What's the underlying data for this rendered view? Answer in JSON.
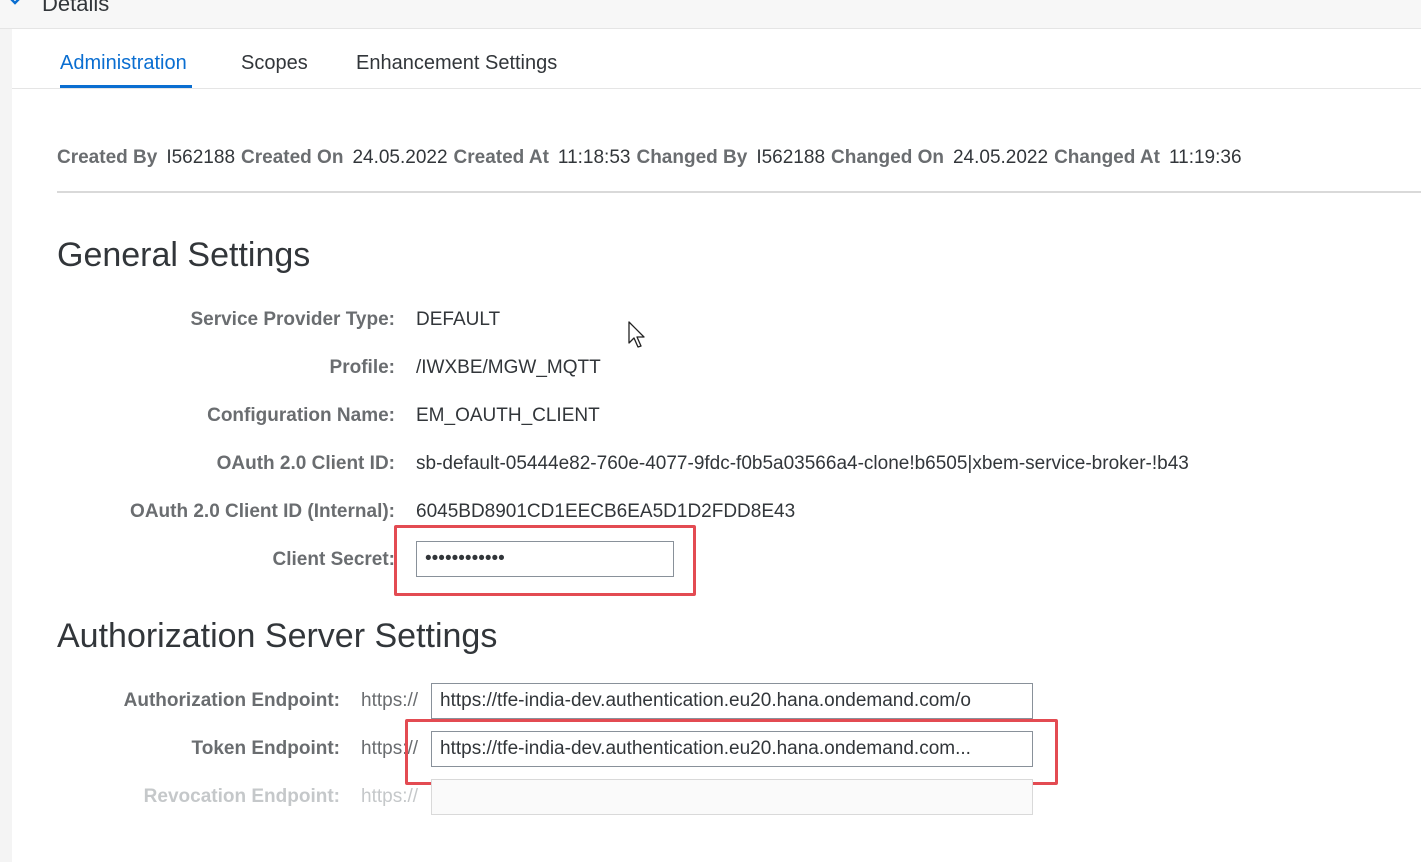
{
  "header": {
    "title": "Details"
  },
  "tabs": [
    {
      "label": "Administration",
      "active": true
    },
    {
      "label": "Scopes",
      "active": false
    },
    {
      "label": "Enhancement Settings",
      "active": false
    }
  ],
  "audit": {
    "created_by_label": "Created By",
    "created_by": "I562188",
    "created_on_label": "Created On",
    "created_on": "24.05.2022",
    "created_at_label": "Created At",
    "created_at": "11:18:53",
    "changed_by_label": "Changed By",
    "changed_by": "I562188",
    "changed_on_label": "Changed On",
    "changed_on": "24.05.2022",
    "changed_at_label": "Changed At",
    "changed_at": "11:19:36"
  },
  "general": {
    "title": "General Settings",
    "service_provider_type_label": "Service Provider Type:",
    "service_provider_type": "DEFAULT",
    "profile_label": "Profile:",
    "profile": "/IWXBE/MGW_MQTT",
    "configuration_name_label": "Configuration Name:",
    "configuration_name": "EM_OAUTH_CLIENT",
    "client_id_label": "OAuth 2.0 Client ID:",
    "client_id": "sb-default-05444e82-760e-4077-9fdc-f0b5a03566a4-clone!b6505|xbem-service-broker-!b43",
    "client_id_internal_label": "OAuth 2.0 Client ID (Internal):",
    "client_id_internal": "6045BD8901CD1EECB6EA5D1D2FDD8E43",
    "client_secret_label": "Client Secret:",
    "client_secret": "••••••••••••"
  },
  "auth_server": {
    "title": "Authorization Server Settings",
    "prefix": "https://",
    "authorization_endpoint_label": "Authorization Endpoint:",
    "authorization_endpoint": "https://tfe-india-dev.authentication.eu20.hana.ondemand.com/o",
    "token_endpoint_label": "Token Endpoint:",
    "token_endpoint": "https://tfe-india-dev.authentication.eu20.hana.ondemand.com...",
    "revocation_endpoint_label": "Revocation Endpoint:",
    "revocation_endpoint": ""
  },
  "colors": {
    "accent": "#0a6ed1",
    "highlight": "#e34b52",
    "label": "#6a6d70",
    "text": "#32363a"
  },
  "icons": {
    "header_toggle": "chevron-down-icon",
    "pointer": "mouse-cursor-icon"
  }
}
